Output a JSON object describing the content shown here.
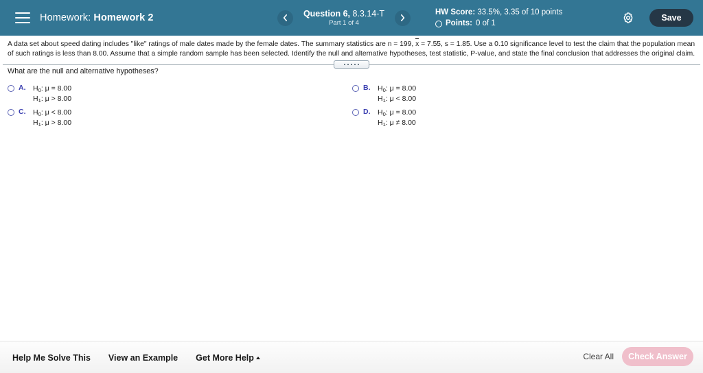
{
  "header": {
    "menu_icon": "hamburger-icon",
    "assignment_label": "Homework:",
    "assignment_name": "Homework 2",
    "prev_icon": "chevron-left-icon",
    "next_icon": "chevron-right-icon",
    "question_label": "Question 6,",
    "question_code": "8.3.14-T",
    "part_text": "Part 1 of 4",
    "hw_score_label": "HW Score:",
    "hw_score_value": "33.5%, 3.35 of 10 points",
    "points_label": "Points:",
    "points_value": "0 of 1",
    "points_icon": "circle-outline-icon",
    "settings_icon": "gear-icon",
    "save_label": "Save",
    "bg_color": "#337694",
    "save_bg_color": "#253746"
  },
  "question": {
    "body_part1": "A data set about speed dating includes \"like\" ratings of male dates made by the female dates. The summary statistics are n = 199, ",
    "body_xbar": "x",
    "body_part2": " = 7.55, s = 1.85. Use a 0.10 significance level to test the claim that the population mean of such ratings is less than 8.00. Assume that a simple random sample has been selected. Identify the null and alternative hypotheses, test statistic, P-value, and state the final conclusion that addresses the original claim.",
    "prompt": "What are the null and alternative hypotheses?",
    "drag_handle": "resize-handle"
  },
  "choices": [
    {
      "letter": "A.",
      "null_pre": "H",
      "null_sub": "0",
      "null_post": ": μ = 8.00",
      "alt_pre": "H",
      "alt_sub": "1",
      "alt_post": ": μ > 8.00",
      "selected": false
    },
    {
      "letter": "B.",
      "null_pre": "H",
      "null_sub": "0",
      "null_post": ": μ = 8.00",
      "alt_pre": "H",
      "alt_sub": "1",
      "alt_post": ": μ < 8.00",
      "selected": false
    },
    {
      "letter": "C.",
      "null_pre": "H",
      "null_sub": "0",
      "null_post": ": μ < 8.00",
      "alt_pre": "H",
      "alt_sub": "1",
      "alt_post": ": μ > 8.00",
      "selected": false
    },
    {
      "letter": "D.",
      "null_pre": "H",
      "null_sub": "0",
      "null_post": ": μ = 8.00",
      "alt_pre": "H",
      "alt_sub": "1",
      "alt_post": ": μ ≠ 8.00",
      "selected": false
    }
  ],
  "footer": {
    "help_me_solve_this": "Help Me Solve This",
    "view_an_example": "View an Example",
    "get_more_help": "Get More Help",
    "get_more_help_icon": "caret-up-icon",
    "clear_all": "Clear All",
    "check_answer": "Check Answer",
    "check_answer_bg": "#f0bfcb"
  }
}
